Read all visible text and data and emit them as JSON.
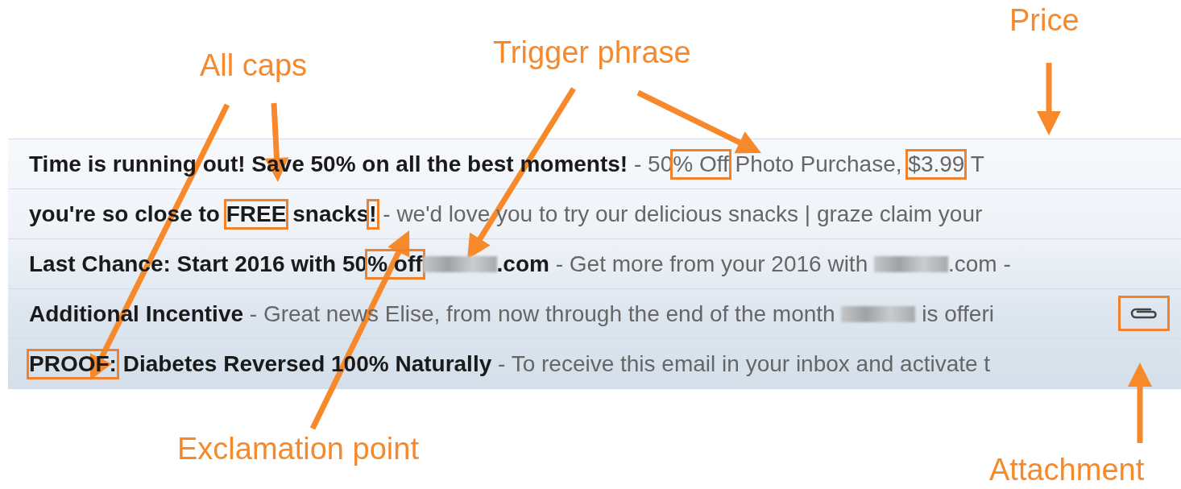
{
  "annotations": [
    {
      "label": "All caps"
    },
    {
      "label": "Trigger phrase"
    },
    {
      "label": "Price"
    },
    {
      "label": "Exclamation point"
    },
    {
      "label": "Attachment"
    }
  ],
  "emails": [
    {
      "subject": [
        {
          "kind": "text",
          "text": "Time is running out! Save 50% on all the best moments!",
          "boxed": false
        }
      ],
      "snippet": [
        {
          "kind": "text",
          "text": " - 50",
          "boxed": false
        },
        {
          "kind": "text",
          "text": "% Off",
          "boxed": true
        },
        {
          "kind": "text",
          "text": " Photo Purchase, ",
          "boxed": false
        },
        {
          "kind": "text",
          "text": "$3.99",
          "boxed": true
        },
        {
          "kind": "text",
          "text": " T",
          "boxed": false
        }
      ],
      "attachment": false
    },
    {
      "subject": [
        {
          "kind": "text",
          "text": "you're so close to ",
          "boxed": false
        },
        {
          "kind": "text",
          "text": "FREE",
          "boxed": true
        },
        {
          "kind": "text",
          "text": " snacks",
          "boxed": false
        },
        {
          "kind": "text",
          "text": "!",
          "boxed": true
        }
      ],
      "snippet": [
        {
          "kind": "text",
          "text": " - we'd love you to try our delicious snacks | graze claim your",
          "boxed": false
        }
      ],
      "attachment": false
    },
    {
      "subject": [
        {
          "kind": "text",
          "text": "Last Chance: Start 2016 with 50",
          "boxed": false
        },
        {
          "kind": "text",
          "text": "% off",
          "boxed": true
        },
        {
          "kind": "redacted"
        },
        {
          "kind": "text",
          "text": ".com",
          "boxed": false
        }
      ],
      "snippet": [
        {
          "kind": "text",
          "text": " - Get more from your 2016 with ",
          "boxed": false
        },
        {
          "kind": "redacted"
        },
        {
          "kind": "text",
          "text": ".com -",
          "boxed": false
        }
      ],
      "attachment": false
    },
    {
      "subject": [
        {
          "kind": "text",
          "text": "Additional Incentive",
          "boxed": false
        }
      ],
      "snippet": [
        {
          "kind": "text",
          "text": " - Great news Elise, from now through the end of the month ",
          "boxed": false
        },
        {
          "kind": "redacted"
        },
        {
          "kind": "text",
          "text": " is offeri",
          "boxed": false
        }
      ],
      "attachment": true
    },
    {
      "subject": [
        {
          "kind": "text",
          "text": "PROOF:",
          "boxed": true
        },
        {
          "kind": "text",
          "text": " Diabetes Reversed 100% Naturally",
          "boxed": false
        }
      ],
      "snippet": [
        {
          "kind": "text",
          "text": " - To receive this email in your inbox and activate t",
          "boxed": false
        }
      ],
      "attachment": false
    }
  ]
}
